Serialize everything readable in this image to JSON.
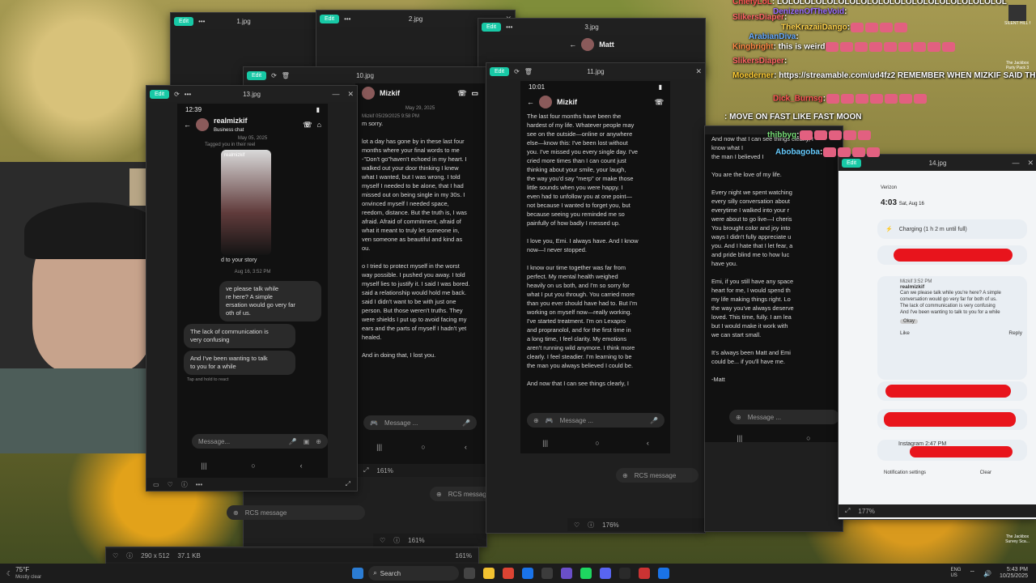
{
  "chat": [
    {
      "user": "ChiefyLoL",
      "text": ": LOLOLOLOLOLOLOLOLOLOLOLOLOLOLOLOLOLOLOLOL",
      "color": "#ff5555"
    },
    {
      "user": "DenizenOfTheVoid",
      "text": ":",
      "color": "#9a6bff"
    },
    {
      "user": "SlikersDiaper",
      "text": ":",
      "color": "#ff6666"
    },
    {
      "user": "TheKrazaiiDango",
      "text": ":",
      "color": "#ffd24a"
    },
    {
      "user": "ArabianDiva",
      "text": ":",
      "color": "#66aaff"
    },
    {
      "user": "Kingbright",
      "text": ": this is weird",
      "color": "#ff8844"
    },
    {
      "user": "SlikersDiaper",
      "text": ":",
      "color": "#ff6666"
    },
    {
      "user": "Moederner",
      "text": ": https://streamable.com/ud4fz2 REMEMBER WHEN MIZKIF SAID THIS ABOUT",
      "color": "#ffcc33"
    },
    {
      "user": "Dick_Burnsg",
      "text": ":",
      "color": "#ff5555"
    },
    {
      "user": "",
      "text": ": MOVE ON FAST LIKE FAST MOON",
      "color": "#ffffff"
    },
    {
      "user": "thibbyg",
      "text": ":",
      "color": "#77dd77"
    },
    {
      "user": "Abobagoba",
      "text": ":",
      "color": "#66ccff"
    }
  ],
  "windows": {
    "edit_label": "Edit",
    "w1": {
      "title": "1.jpg"
    },
    "w2": {
      "title": "2.jpg"
    },
    "w3": {
      "title": "3.jpg",
      "contact": "Matt"
    },
    "w10": {
      "title": "10.jpg",
      "zoom": "161%",
      "contact": "Mizkif",
      "date": "May 29, 2025",
      "ts": "05/29/2025 9:58 PM",
      "body": "m sorry.\n\nlot a day has gone by in these last four\nmonths where your final words to me\n-\"Don't go\"haven't echoed in my heart. I\nwalked out your door thinking I knew\nwhat I wanted, but I was wrong. I told\nmyself I needed to be alone, that I had\nmissed out on being single in my 30s. I\nonvinced myself I needed space,\nreedom, distance. But the truth is, I was\nafraid. Afraid of commitment, afraid of\nwhat it meant to truly let someone in,\nven someone as beautiful and kind as\nou.\n\no I tried to protect myself in the worst\nway possible. I pushed you away. I told\nmyself lies to justify it. I said I was bored.\nsaid a relationship would hold me back.\nsaid I didn't want to be with just one\nperson. But those weren't truths. They\nwere shields I put up to avoid facing my\nears and the parts of myself I hadn't yet\nhealed.\n\nAnd in doing that, I lost you.",
      "message_placeholder": "Message ..."
    },
    "w11": {
      "title": "11.jpg",
      "zoom": "176%",
      "time": "10:01",
      "contact": "Mizkif",
      "body": "The last four months have been the\nhardest of my life. Whatever people may\nsee on the outside—online or anywhere\nelse—know this: I've been lost without\nyou. I've missed you every single day. I've\ncried more times than I can count just\nthinking about your smile, your laugh,\nthe way you'd say \"merp\" or make those\nlittle sounds when you were happy. I\neven had to unfollow you at one point—\nnot because I wanted to forget you, but\nbecause seeing you reminded me so\npainfully of how badly I messed up.\n\nI love you, Emi. I always have. And I know\nnow—I never stopped.\n\nI know our time together was far from\nperfect. My mental health weighed\nheavily on us both, and I'm so sorry for\nwhat I put you through. You carried more\nthan you ever should have had to. But I'm\nworking on myself now—really working.\nI've started treatment. I'm on Lexapro\nand propranolol, and for the first time in\na long time, I feel clarity. My emotions\naren't running wild anymore. I think more\nclearly. I feel steadier. I'm learning to be\nthe man you always believed I could be.\n\nAnd now that I can see things clearly, I",
      "message_placeholder": "Message ...",
      "rcs": "RCS message"
    },
    "w13": {
      "title": "13.jpg",
      "time": "12:39",
      "contact": "realmizkif",
      "contact_sub": "Business chat",
      "date": "May 05, 2025",
      "tagged": "Tagged you in their reel",
      "reel_user": "realmizkif",
      "story": "d to your story",
      "date2": "Aug 16, 3:52 PM",
      "b1": "ve please talk while\nre here? A simple\nersation would go very far\noth of us.",
      "b2": "The lack of communication is\nvery confusing",
      "b3": "And I've been wanting to talk\nto you for a while",
      "hint": "Tap and hold to react",
      "message_placeholder": "Message...",
      "size": "290 x 512",
      "filesize": "37.1 KB",
      "rcs": "RCS message"
    },
    "wright": {
      "body": "And now that I can see things clearly, I\nknow what I\nthe man I believed I\n\nYou are the love of my life.\n\nEvery night we spent watching\nevery silly conversation about\neverytime I walked into your r\nwere about to go live—I cheris\nYou brought color and joy into\nways I didn't fully appreciate u\nyou. And I hate that I let fear, a\nand pride blind me to how luc\nhave you.\n\nEmi, if you still have any space\nheart for me, I would spend th\nmy life making things right. Lo\nthe way you've always deserve\nloved. This time, fully. I am lea\nbut I would make it work with\nwe can start small.\n\nIt's always been Matt and Emi\ncould be... if you'll have me.\n\n-Matt",
      "message_placeholder": "Message ..."
    },
    "w14": {
      "title": "14.jpg",
      "zoom": "177%",
      "carrier": "Verizon",
      "time": "4:03",
      "date": "Sat, Aug 16",
      "charging": "Charging (1 h 2 m until full)",
      "notif_app": "Mizkif",
      "notif_time": "3:52 PM",
      "notif_sender": "realmizkif",
      "notif_text": "Can we please talk while you're here? A simple conversation would go very far for both of us.\nThe lack of communication is very confusing\nAnd I've been wanting to talk to you for a while",
      "okay": "Okay",
      "like": "Like",
      "reply": "Reply",
      "instagram": "Instagram",
      "insta_time": "2:47 PM",
      "settings": "Notification settings",
      "clear": "Clear"
    }
  },
  "taskbar": {
    "weather_temp": "75°F",
    "weather_desc": "Mostly clear",
    "search": "Search",
    "lang": "ENG\nUS",
    "time": "5:43 PM",
    "date": "10/25/2025"
  },
  "corner": {
    "silent_hill": "SILENT HILL f",
    "jackbox1": "The Jackbox\nParty Pack 3",
    "jackbox2": "The Jackbox\nSurvey Sca..."
  }
}
